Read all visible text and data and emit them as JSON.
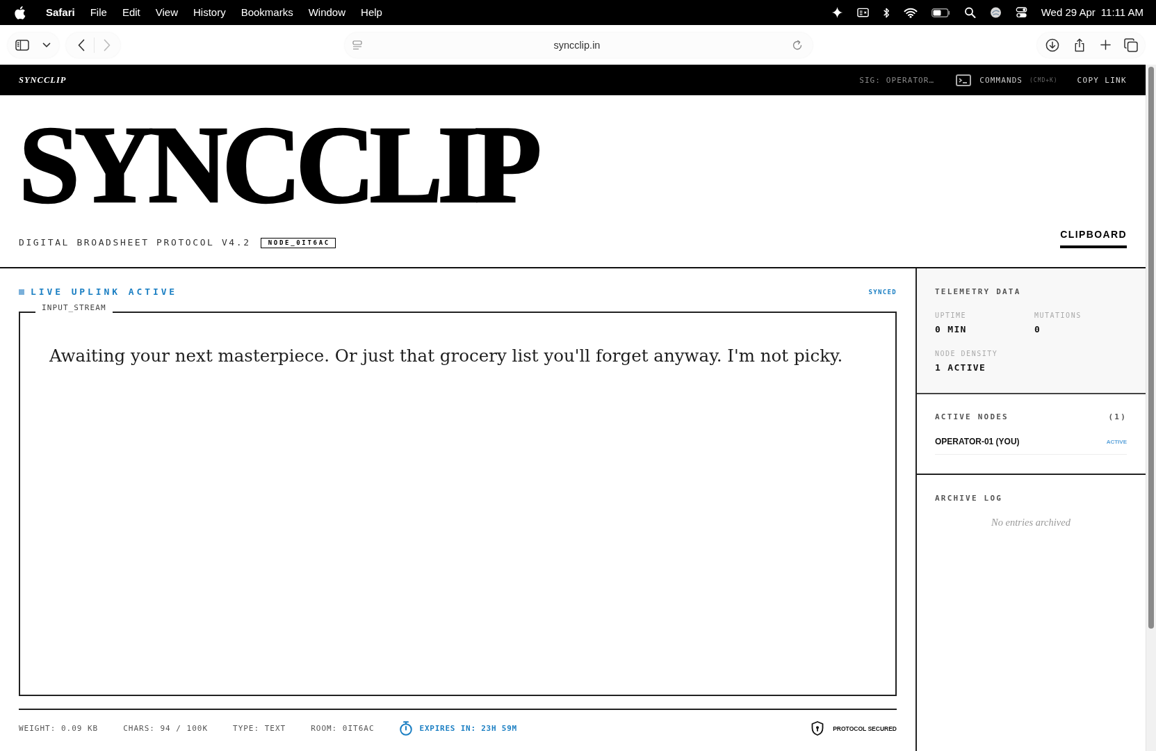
{
  "menu_bar": {
    "app_name": "Safari",
    "menus": [
      "File",
      "Edit",
      "View",
      "History",
      "Bookmarks",
      "Window",
      "Help"
    ],
    "date": "Wed 29 Apr",
    "time": "11:11 AM"
  },
  "browser": {
    "url": "syncclip.in",
    "back_enabled": true,
    "forward_enabled": false
  },
  "site_header": {
    "brand": "SYNCCLIP",
    "signature": "SIG: OPERATOR…",
    "commands": {
      "label": "COMMANDS",
      "shortcut": "(CMD+K)"
    },
    "copy_link": "COPY LINK"
  },
  "masthead": {
    "title": "SYNCCLIP",
    "subtitle": "DIGITAL BROADSHEET PROTOCOL V4.2",
    "node_badge": "NODE_0IT6AC",
    "tabs": [
      {
        "label": "CLIPBOARD",
        "selected": true
      }
    ]
  },
  "editor": {
    "status": "LIVE UPLINK ACTIVE",
    "sync_state": "SYNCED",
    "stream_label": "INPUT_STREAM",
    "placeholder": "Awaiting your next masterpiece. Or just that grocery list you'll forget anyway. I'm not picky.",
    "stats": [
      "WEIGHT: 0.09 KB",
      "CHARS: 94 / 100K",
      "TYPE: TEXT",
      "ROOM: 0IT6AC"
    ],
    "expiry": "EXPIRES IN: 23H 59M",
    "security": "PROTOCOL SECURED"
  },
  "telemetry": {
    "title": "TELEMETRY DATA",
    "metrics": [
      {
        "label": "UPTIME",
        "value": "0 MIN"
      },
      {
        "label": "MUTATIONS",
        "value": "0"
      },
      {
        "label": "NODE DENSITY",
        "value": "1 ACTIVE"
      }
    ]
  },
  "active_nodes": {
    "title": "ACTIVE NODES",
    "count": "(1)",
    "nodes": [
      {
        "name": "OPERATOR-01 (YOU)",
        "status": "ACTIVE"
      }
    ]
  },
  "archive_log": {
    "title": "ARCHIVE LOG",
    "empty_message": "No entries archived"
  }
}
